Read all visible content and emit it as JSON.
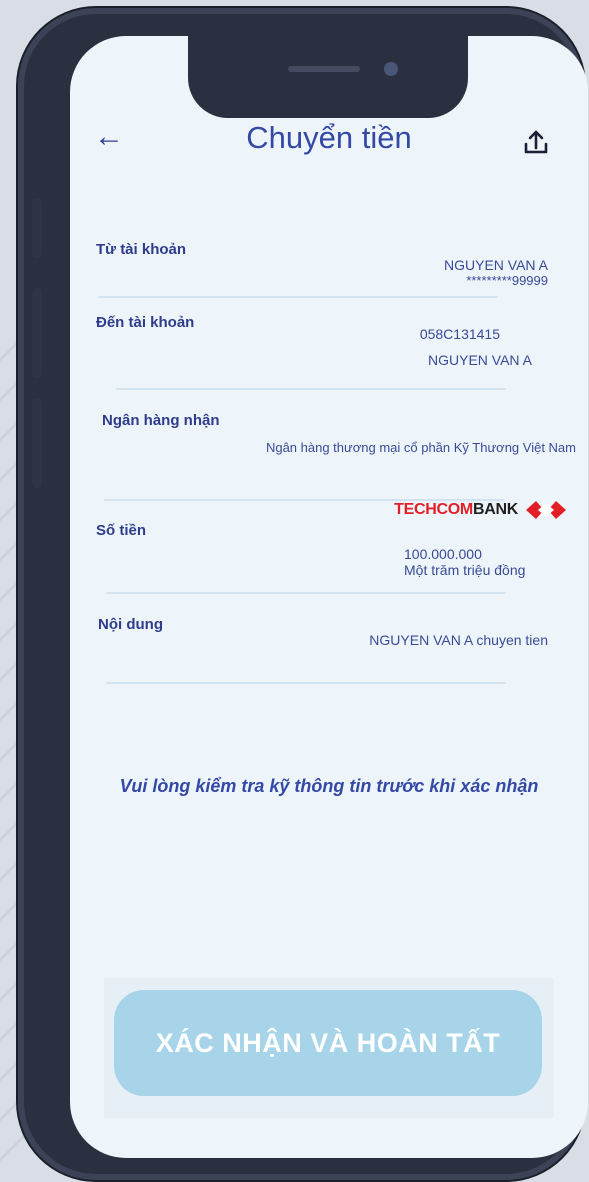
{
  "header": {
    "title": "Chuyển tiền",
    "back_icon": "back-arrow-icon",
    "share_icon": "share-upload-icon"
  },
  "from_account": {
    "label": "Từ tài khoản",
    "name": "NGUYEN VAN A",
    "number": "*********99999"
  },
  "to_account": {
    "label": "Đến tài khoản",
    "number": "058C131415",
    "name": "NGUYEN VAN A"
  },
  "receiving_bank": {
    "label": "Ngân hàng nhận",
    "value": "Ngân hàng thương mại cổ phần Kỹ Thương Việt Nam",
    "logo_text_red": "TECHCOM",
    "logo_text_dark": "BANK"
  },
  "amount": {
    "label": "Số tiền",
    "value": "100.000.000",
    "in_words": "Một trăm triệu đồng"
  },
  "content": {
    "label": "Nội dung",
    "value": "NGUYEN VAN A chuyen tien"
  },
  "notice": "Vui lòng kiểm tra kỹ thông tin trước khi xác nhận",
  "confirm_button": "XÁC NHẬN VÀ HOÀN TẤT",
  "colors": {
    "title": "#3448a6",
    "label": "#2f3c8c",
    "button": "#a8d4ea",
    "techcombank_red": "#e21f26"
  }
}
